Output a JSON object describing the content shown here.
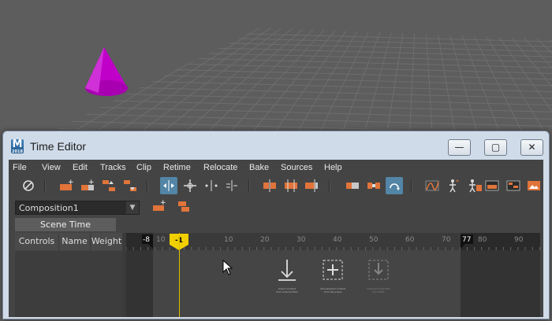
{
  "window": {
    "title": "Time Editor",
    "logo_letter": "M",
    "logo_sub": "2018"
  },
  "caption_buttons": {
    "minimize": "—",
    "maximize": "▢",
    "close": "✕"
  },
  "menu": [
    "File",
    "View",
    "Edit",
    "Tracks",
    "Clip",
    "Retime",
    "Relocate",
    "Bake",
    "Sources",
    "Help"
  ],
  "composition": {
    "value": "Composition1"
  },
  "left_panel": {
    "tab": "Scene Time",
    "columns": [
      "Controls",
      "Name",
      "Weight"
    ]
  },
  "timeline": {
    "start_marker": "-8",
    "end_marker": "77",
    "playhead": "-1",
    "ruler_labels": [
      "10",
      "10",
      "20",
      "30",
      "40",
      "50",
      "60",
      "70",
      "80",
      "90"
    ]
  },
  "drop_hints": [
    {
      "icon": "import-down-arrow-icon",
      "text": "Import content from external files"
    },
    {
      "icon": "add-plus-icon",
      "text": "Add selected content from the scene"
    },
    {
      "icon": "drag-drop-icon",
      "text": "Drag-and-drag files into Editor"
    }
  ],
  "colors": {
    "accent_orange": "#e0743a",
    "active_blue": "#5285a6",
    "playhead_yellow": "#f0d000",
    "cone_magenta": "#c000c8"
  }
}
